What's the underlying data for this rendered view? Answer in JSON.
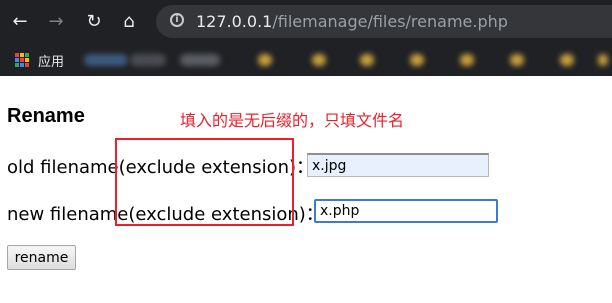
{
  "browser": {
    "url_host": "127.0.0.1",
    "url_path": "/filemanage/files/rename.php",
    "bookmarks_apps_label": "应用",
    "apps_icon_colors": [
      "#ea4335",
      "#fbbc05",
      "#34a853",
      "#4285f4",
      "#ea4335",
      "#fbbc05",
      "#34a853",
      "#4285f4",
      "#ea4335"
    ]
  },
  "page": {
    "title": "Rename",
    "annotation": "填入的是无后缀的，只填文件名",
    "old_label": "old filename(exclude extension)：",
    "new_label": "new filename(exclude extension)：",
    "old_value": "x.jpg",
    "new_value": "x.php",
    "button_label": "rename"
  },
  "colors": {
    "annotation_red": "#e8212d",
    "input_autofill_bg": "#e8f0fe",
    "focus_border": "#3a7bd5"
  }
}
